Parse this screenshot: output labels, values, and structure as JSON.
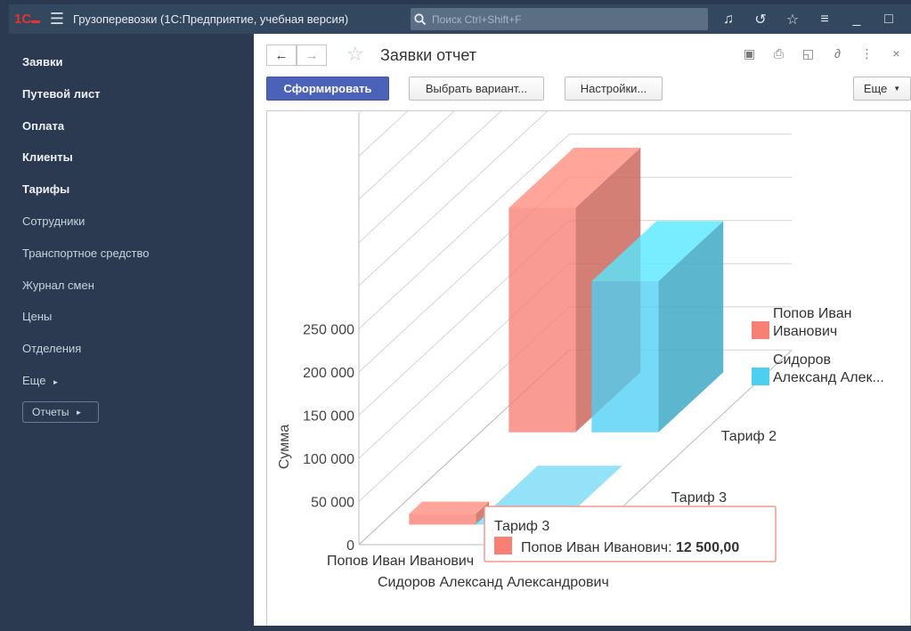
{
  "app": {
    "title": "Грузоперевозки  (1С:Предприятие, учебная версия)",
    "search_placeholder": "Поиск Ctrl+Shift+F",
    "menu_icon": "hamburger-icon",
    "toolbar_icons": [
      "bell-icon",
      "history-icon",
      "star-icon",
      "settings-icon",
      "minimize-icon",
      "maximize-icon"
    ]
  },
  "sidebar": {
    "items": [
      {
        "label": "Заявки",
        "bold": true
      },
      {
        "label": "Путевой лист",
        "bold": true
      },
      {
        "label": "Оплата",
        "bold": true
      },
      {
        "label": "Клиенты",
        "bold": true
      },
      {
        "label": "Тарифы",
        "bold": true
      },
      {
        "label": "Сотрудники",
        "bold": false
      },
      {
        "label": "Транспортное средство",
        "bold": false
      },
      {
        "label": "Журнал смен",
        "bold": false
      },
      {
        "label": "Цены",
        "bold": false
      },
      {
        "label": "Отделения",
        "bold": false
      },
      {
        "label": "Еще",
        "bold": false
      }
    ],
    "reports_label": "Отчеты"
  },
  "page": {
    "title": "Заявки отчет",
    "generate_label": "Сформировать",
    "choose_variant_label": "Выбрать вариант...",
    "settings_label": "Настройки...",
    "more_label": "Еще",
    "header_icons": [
      "save-icon",
      "print-icon",
      "preview-icon",
      "link-icon",
      "more-icon",
      "close-icon"
    ]
  },
  "chart_data": {
    "type": "bar",
    "ylabel": "Сумма",
    "ylim": [
      0,
      250000
    ],
    "yticks": [
      "0",
      "50 000",
      "100 000",
      "150 000",
      "200 000",
      "250 000"
    ],
    "categories": [
      "Попов Иван Иванович",
      "Сидоров Александ Александрович"
    ],
    "depth_categories": [
      "Тариф 3",
      "Тариф 2"
    ],
    "series": [
      {
        "name": "Попов Иван Иванович",
        "legend_line1": "Попов Иван",
        "legend_line2": "Иванович",
        "color": "#f77f73",
        "values": [
          {
            "tariff": "Тариф 3",
            "value": 12500
          },
          {
            "tariff": "Тариф 2",
            "value": 260000
          }
        ]
      },
      {
        "name": "Сидоров Александ Александрович",
        "legend_line1": "Сидоров",
        "legend_line2": "Александ Алек...",
        "color": "#4dcff2",
        "values": [
          {
            "tariff": "Тариф 3",
            "value": 0
          },
          {
            "tariff": "Тариф 2",
            "value": 175000
          }
        ]
      }
    ],
    "legend_position": "right",
    "tooltip": {
      "title": "Тариф 3",
      "label": "Попов Иван Иванович: ",
      "value": "12 500,00"
    }
  }
}
